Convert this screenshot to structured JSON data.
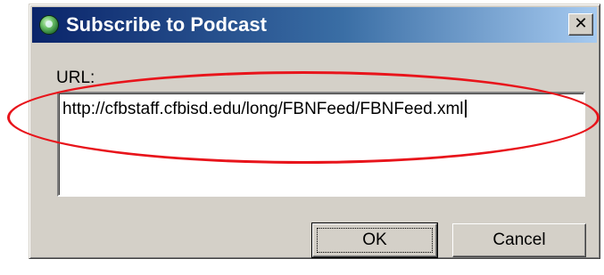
{
  "dialog": {
    "title": "Subscribe to Podcast",
    "title_icon": "podcast-globe-icon",
    "close_symbol": "✕"
  },
  "form": {
    "url_label": "URL:",
    "url_value": "http://cfbstaff.cfbisd.edu/long/FBNFeed/FBNFeed.xml"
  },
  "buttons": {
    "ok_label": "OK",
    "cancel_label": "Cancel"
  },
  "annotation": {
    "shape": "ellipse",
    "color": "#e8141b"
  },
  "colors": {
    "titlebar_start": "#0a246a",
    "titlebar_end": "#a6caf0",
    "dialog_face": "#d4d0c8"
  }
}
